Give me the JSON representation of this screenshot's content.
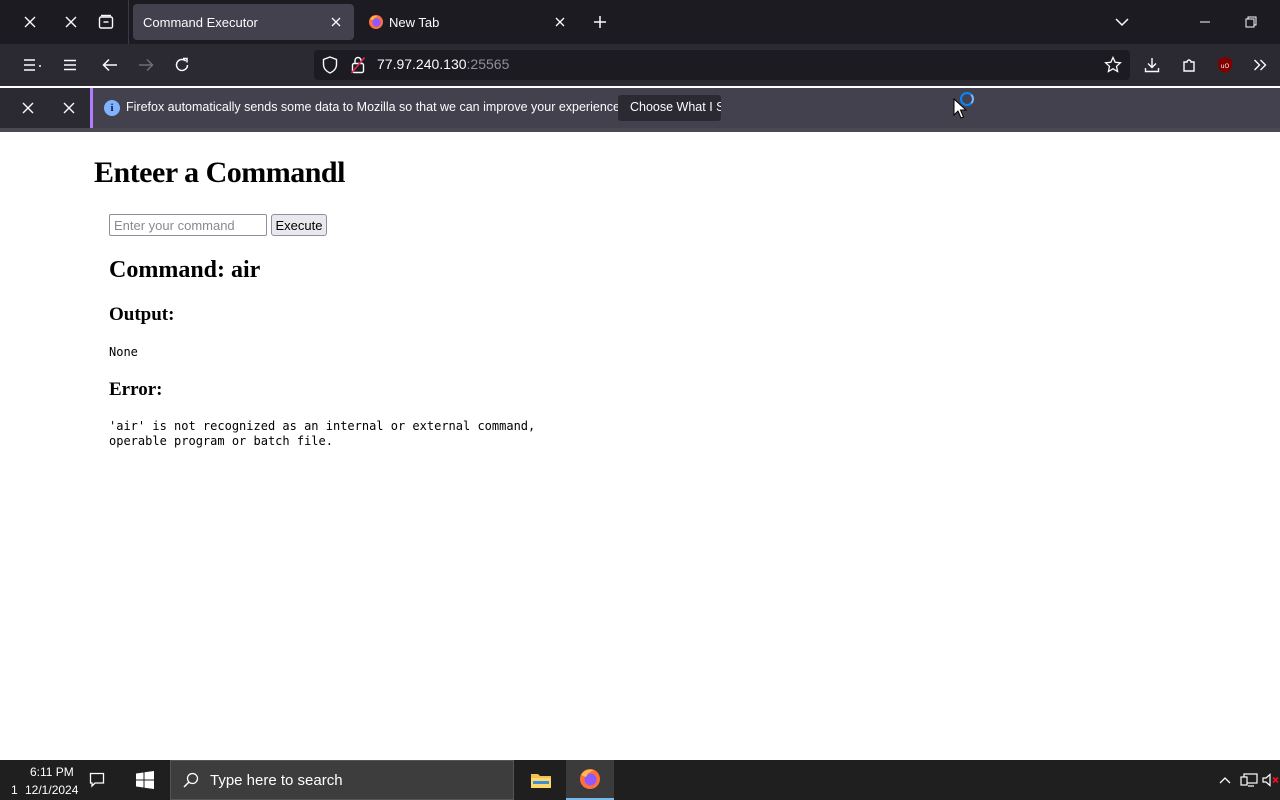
{
  "browser": {
    "tabs": [
      {
        "title": "Command Executor",
        "active": true
      },
      {
        "title": "New Tab",
        "active": false
      }
    ],
    "url": {
      "host": "77.97.240.130",
      "port": ":25565"
    },
    "notification": {
      "text": "Firefox automatically sends some data to Mozilla so that we can improve your experience.",
      "button_label": "Choose What I Sh"
    }
  },
  "page": {
    "title": "Enteer a Commandl",
    "input_placeholder": "Enter your command",
    "input_value": "",
    "execute_label": "Execute",
    "command_heading": "Command: air",
    "output_heading": "Output:",
    "output_text": "None",
    "error_heading": "Error:",
    "error_text": "'air' is not recognized as an internal or external command,\noperable program or batch file."
  },
  "taskbar": {
    "time": "6:11 PM",
    "date_lead": "1",
    "date": "12/1/2024",
    "search_placeholder": "Type here to search"
  },
  "colors": {
    "tabstrip_bg": "#1c1b22",
    "toolbar_bg": "#2b2a33",
    "accent": "#b07cff",
    "info": "#80b3ff"
  }
}
